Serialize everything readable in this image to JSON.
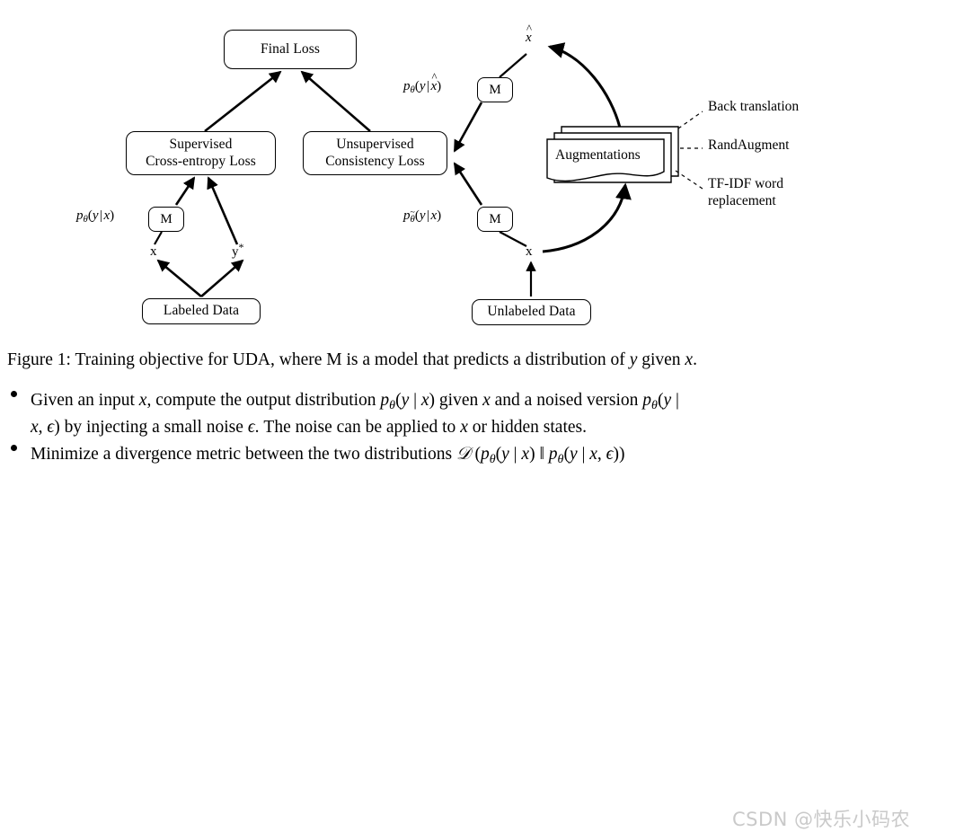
{
  "figure": {
    "nodes": {
      "final_loss": "Final Loss",
      "supervised_loss_line1": "Supervised",
      "supervised_loss_line2": "Cross-entropy Loss",
      "unsupervised_loss_line1": "Unsupervised",
      "unsupervised_loss_line2": "Consistency Loss",
      "labeled_data": "Labeled Data",
      "unlabeled_data": "Unlabeled Data",
      "model_box": "M",
      "augmentations": "Augmentations"
    },
    "math_labels": {
      "p_theta_y_given_x": "pθ(y | x)",
      "p_theta_y_given_xhat": "pθ(y | x̂)",
      "p_thetatilde_y_given_x": "pθ̃(y | x)",
      "x_labeled": "x",
      "y_star": "y*",
      "x_unlabeled": "x",
      "x_hat": "x̂"
    },
    "augmentation_methods": [
      "Back translation",
      "RandAugment",
      "TF-IDF word replacement"
    ],
    "augmentation_method_lines": {
      "tfidf_line1": "TF-IDF word",
      "tfidf_line2": "replacement"
    }
  },
  "caption": "Figure 1: Training objective for UDA, where M is a model that predicts a distribution of y given x.",
  "bullets": [
    "Given an input x, compute the output distribution pθ(y | x) given x and a noised version pθ(y | x, ε) by injecting a small noise ε. The noise can be applied to x or hidden states.",
    "Minimize a divergence metric between the two distributions D (pθ(y | x) ‖ pθ(y | x, ε))"
  ],
  "watermark": "CSDN @快乐小码农",
  "colors": {
    "stroke": "#000000",
    "background": "#ffffff",
    "watermark": "#b8b8b8"
  }
}
